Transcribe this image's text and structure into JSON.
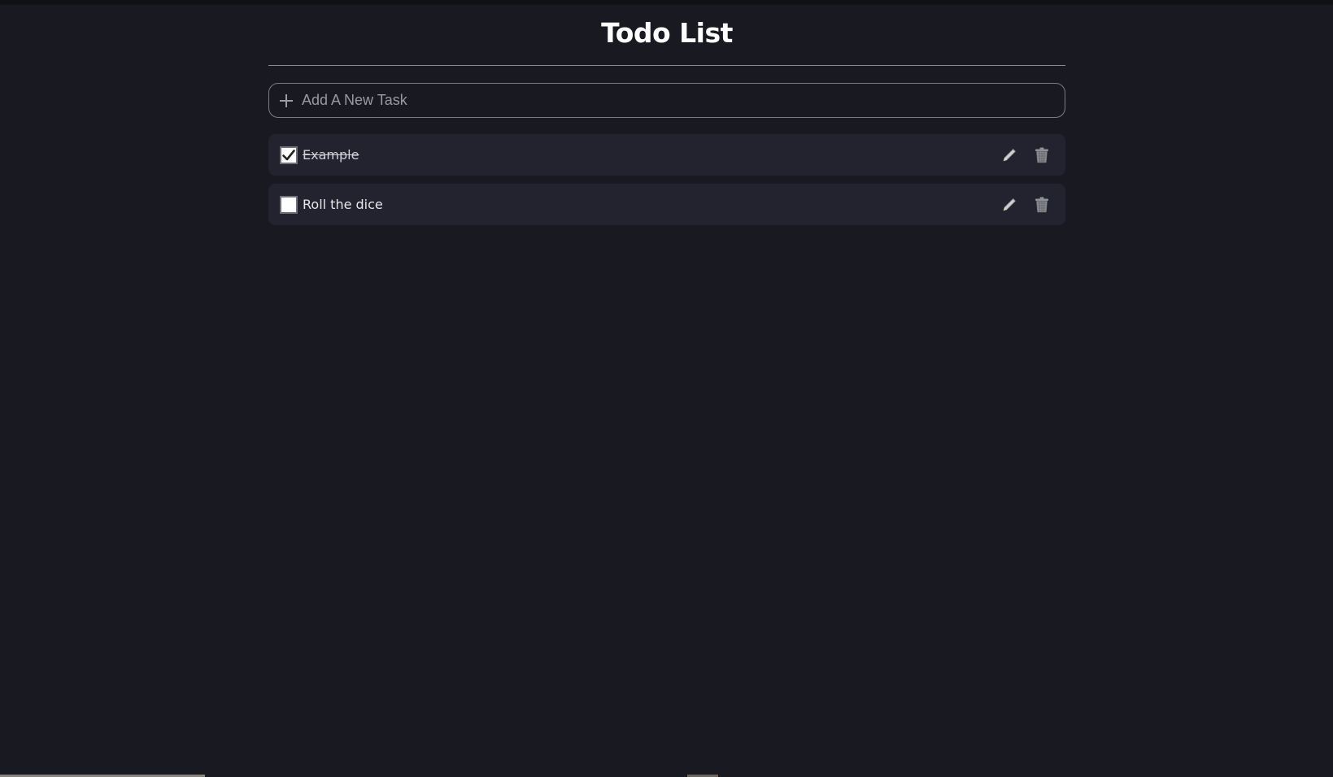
{
  "app": {
    "title": "Todo List"
  },
  "add_task": {
    "placeholder": "Add A New Task",
    "value": "",
    "icon": "plus-icon"
  },
  "tasks": [
    {
      "label": "Example",
      "completed": true,
      "edit_icon": "pencil-icon",
      "delete_icon": "trash-icon"
    },
    {
      "label": "Roll the dice",
      "completed": false,
      "edit_icon": "pencil-icon",
      "delete_icon": "trash-icon"
    }
  ],
  "colors": {
    "background": "#181921",
    "task_background": "#22232f",
    "title": "#ffffff",
    "divider": "#8a8b91"
  }
}
